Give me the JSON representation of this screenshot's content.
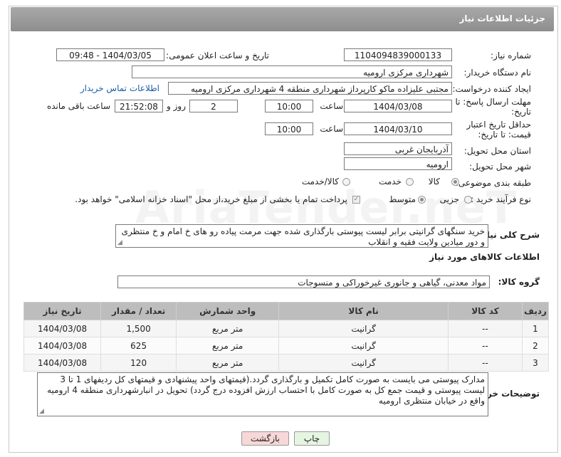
{
  "header": {
    "title": "جزئیات اطلاعات نیاز"
  },
  "form": {
    "need_number_label": "شماره نیاز:",
    "need_number": "1104094839000133",
    "announce_label": "تاریخ و ساعت اعلان عمومی:",
    "announce_value": "1404/03/05 - 09:48",
    "buyer_org_label": "نام دستگاه خریدار:",
    "buyer_org": "شهرداری مرکزی ارومیه",
    "requester_label": "ایجاد کننده درخواست:",
    "requester": "مجتبی علیزاده ماکو کارپرداز شهرداری منطقه 4 شهرداری مرکزی ارومیه",
    "contact_link": "اطلاعات تماس خریدار",
    "deadline_label": "مهلت ارسال پاسخ: تا تاریخ:",
    "deadline_date": "1404/03/08",
    "hour_label": "ساعت",
    "deadline_time": "10:00",
    "days_value": "2",
    "days_label": "روز و",
    "remaining_time": "21:52:08",
    "remaining_label": "ساعت باقی مانده",
    "validity_label": "حداقل تاریخ اعتبار قیمت: تا تاریخ:",
    "validity_date": "1404/03/10",
    "validity_time": "10:00",
    "province_label": "استان محل تحویل:",
    "province": "آذربایجان غربی",
    "city_label": "شهر محل تحویل:",
    "city": "ارومیه",
    "category_label": "طبقه بندی موضوعی:",
    "category_options": [
      "کالا",
      "خدمت",
      "کالا/خدمت"
    ],
    "process_label": "نوع فرآیند خرید :",
    "process_options": [
      "جزیی",
      "متوسط"
    ],
    "process_note": "پرداخت تمام یا بخشی از مبلغ خرید،از محل \"اسناد خزانه اسلامی\" خواهد بود."
  },
  "description": {
    "label": "شرح کلی نیاز:",
    "text": "خرید سنگهای گرانیتی برابر لیست پیوستی بارگذاری شده جهت مرمت پیاده رو های خ امام و خ منتظری و دور میادین ولایت فقیه و انقلاب"
  },
  "goods": {
    "section_title": "اطلاعات کالاهای مورد نیاز",
    "group_label": "گروه کالا:",
    "group_value": "مواد معدنی، گیاهی و جانوری غیرخوراکی و منسوجات"
  },
  "table": {
    "headers": [
      "ردیف",
      "کد کالا",
      "نام کالا",
      "واحد شمارش",
      "تعداد / مقدار",
      "تاریخ نیاز"
    ],
    "rows": [
      [
        "1",
        "--",
        "گرانیت",
        "متر مربع",
        "1,500",
        "1404/03/08"
      ],
      [
        "2",
        "--",
        "گرانیت",
        "متر مربع",
        "625",
        "1404/03/08"
      ],
      [
        "3",
        "--",
        "گرانیت",
        "متر مربع",
        "120",
        "1404/03/08"
      ]
    ]
  },
  "notes": {
    "label": "توضیحات خریدار:",
    "text": "مدارک پیوستی می بایست به صورت کامل تکمیل و بارگذاری گردد.(قیمتهای واحد پیشنهادی و قیمتهای کل ردیفهای 1 تا 3 لیست پیوستی و  قیمت جمع کل به صورت کامل با احتساب ارزش افزوده درج گردد) تحویل در انبارشهرداری منطقه 4 ارومیه واقع در خیابان منتظری ارومیه"
  },
  "buttons": {
    "print": "چاپ",
    "back": "بازگشت"
  },
  "watermark": "AriaTender.neT",
  "colors": {
    "link": "#1a5ea8",
    "header": "#9b9b9b",
    "back_button": "#f7d7d7",
    "print_button": "#e6f5e1"
  }
}
